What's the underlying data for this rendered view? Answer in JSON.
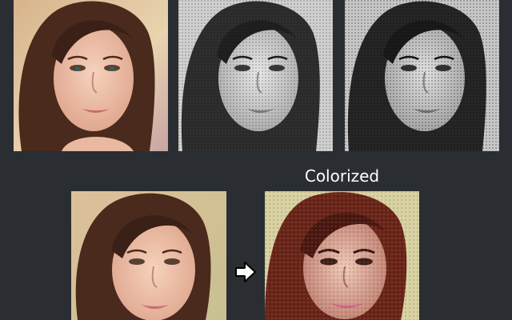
{
  "caption": "Colorized",
  "images": [
    {
      "id": "original-top",
      "kind": "color-portrait"
    },
    {
      "id": "grayscale-1",
      "kind": "grayscale-halftone-portrait"
    },
    {
      "id": "grayscale-2",
      "kind": "grayscale-halftone-portrait"
    },
    {
      "id": "original-bottom",
      "kind": "color-portrait"
    },
    {
      "id": "colorized",
      "kind": "pixelated-colorized-portrait"
    }
  ],
  "icons": {
    "arrow": "arrow-right-icon"
  },
  "colors": {
    "background": "#2a2e33",
    "caption_text": "#ffffff",
    "arrow_fill": "#ffffff",
    "arrow_stroke": "#000000"
  }
}
